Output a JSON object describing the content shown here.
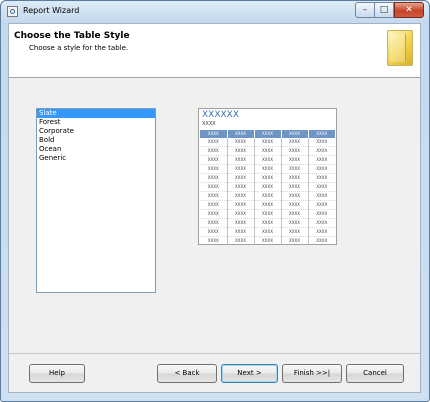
{
  "window": {
    "title": "Report Wizard"
  },
  "caption_buttons": {
    "minimize": "–",
    "maximize": "□",
    "close": "✕"
  },
  "header": {
    "title": "Choose the Table Style",
    "subtitle": "Choose a style for the table.",
    "icon": "report-page-icon"
  },
  "styles": {
    "items": [
      {
        "label": "Slate",
        "selected": true
      },
      {
        "label": "Forest",
        "selected": false
      },
      {
        "label": "Corporate",
        "selected": false
      },
      {
        "label": "Bold",
        "selected": false
      },
      {
        "label": "Ocean",
        "selected": false
      },
      {
        "label": "Generic",
        "selected": false
      }
    ]
  },
  "preview": {
    "title": "XXXXXX",
    "subtitle": "XXXX",
    "cell_text": "XXXX",
    "columns": 5,
    "rows": 13,
    "colors": {
      "header_bg": "#6e95c4",
      "title": "#3c6fb0"
    }
  },
  "buttons": {
    "help": "Help",
    "back": "< Back",
    "next": "Next >",
    "finish": "Finish >>|",
    "cancel": "Cancel"
  }
}
